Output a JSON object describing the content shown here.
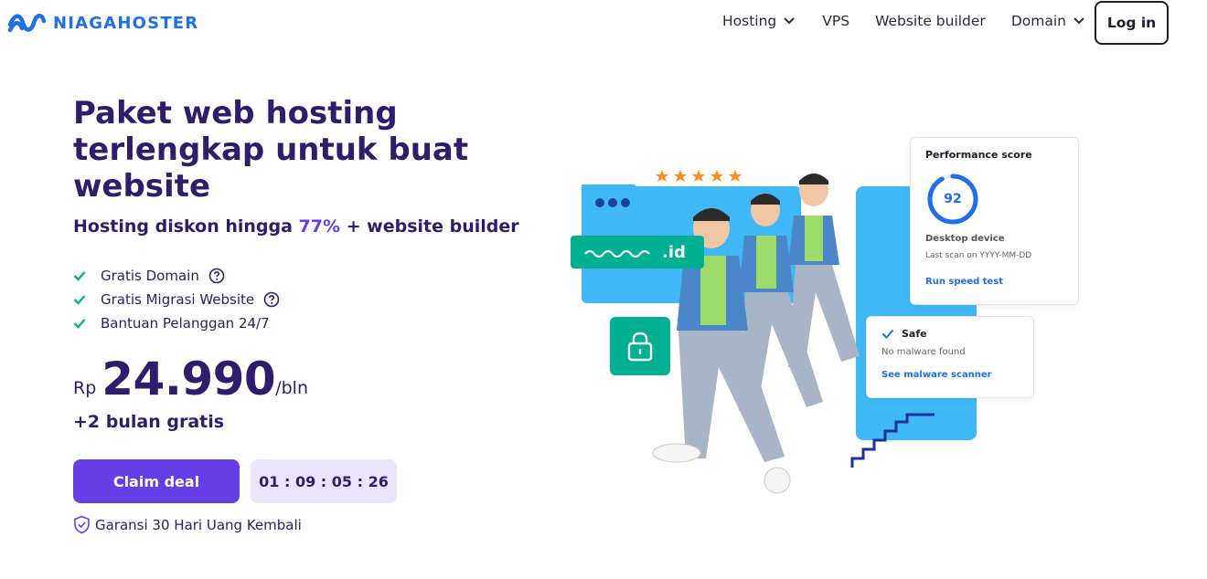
{
  "header": {
    "logo_text": "NIAGAHOSTER",
    "nav": [
      {
        "label": "Hosting",
        "has_dropdown": true
      },
      {
        "label": "VPS",
        "has_dropdown": false
      },
      {
        "label": "Website builder",
        "has_dropdown": false
      },
      {
        "label": "Domain",
        "has_dropdown": true
      }
    ],
    "login_label": "Log in"
  },
  "hero": {
    "headline": "Paket web hosting terlengkap untuk buat website",
    "subhead_prefix": "Hosting diskon hingga ",
    "subhead_discount": "77%",
    "subhead_suffix": " + website builder",
    "features": [
      {
        "label": "Gratis Domain",
        "has_help": true
      },
      {
        "label": "Gratis Migrasi Website",
        "has_help": true
      },
      {
        "label": "Bantuan Pelanggan 24/7",
        "has_help": false
      }
    ],
    "price": {
      "currency": "Rp",
      "amount": "24.990",
      "period": "/bln"
    },
    "bonus": "+2 bulan gratis",
    "cta_label": "Claim deal",
    "timer": "01 : 09 : 05 : 26",
    "guarantee": "Garansi 30 Hari Uang Kembali"
  },
  "illustration": {
    "domain_tld": ".id",
    "rating_stars": 5,
    "performance": {
      "title": "Performance score",
      "score": "92",
      "device": "Desktop device",
      "last_scan": "Last scan on YYYY-MM-DD",
      "link": "Run speed test"
    },
    "security": {
      "title": "Safe",
      "status": "No malware found",
      "link": "See malware scanner"
    }
  },
  "colors": {
    "brand_blue": "#1f6fe8",
    "primary_purple": "#673de6",
    "heading_navy": "#2f1c6a",
    "check_green": "#00b090",
    "timer_bg": "#ebe4ff",
    "illustration_sky": "#3fb8f5",
    "star_orange": "#ff8c1a"
  },
  "icons": [
    "brand-wave-icon",
    "chevron-down-icon",
    "check-icon",
    "help-circle-icon",
    "shield-check-icon",
    "lock-icon",
    "star-icon"
  ]
}
